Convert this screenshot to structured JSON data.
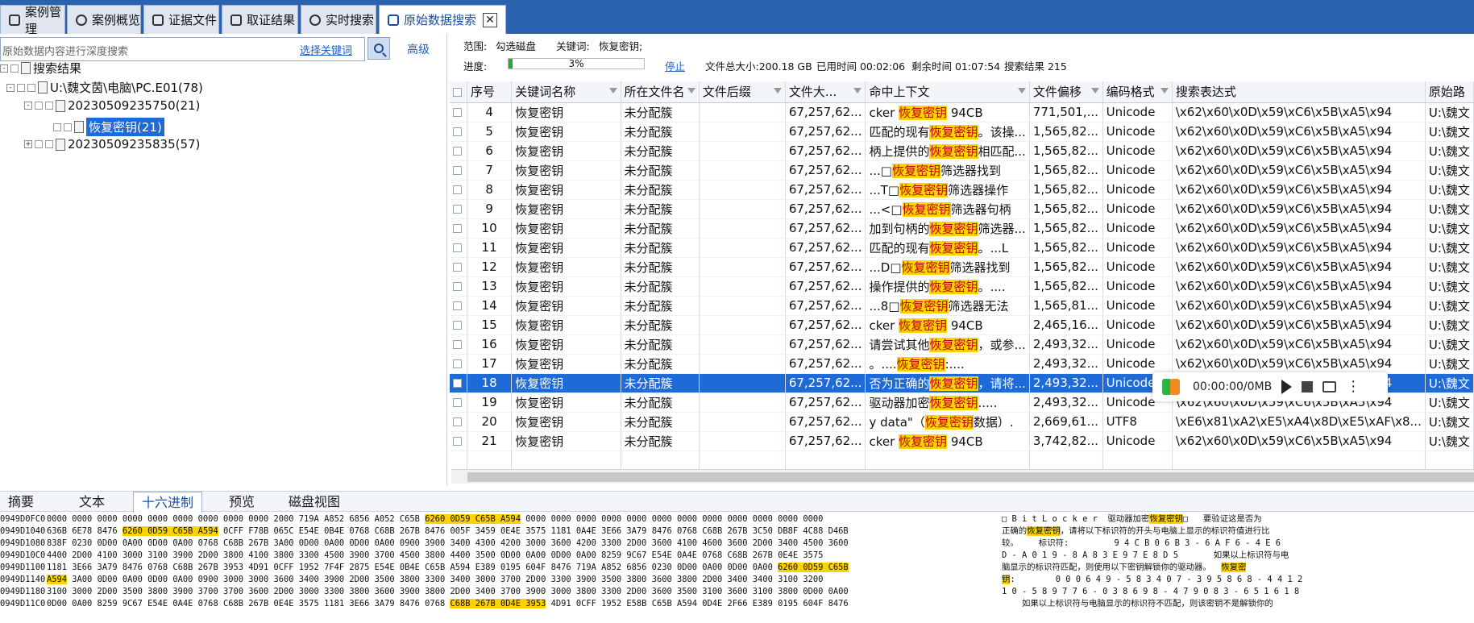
{
  "tabs": [
    {
      "label": "案例管理"
    },
    {
      "label": "案例概览"
    },
    {
      "label": "证据文件"
    },
    {
      "label": "取证结果"
    },
    {
      "label": "实时搜索"
    },
    {
      "label": "原始数据搜索"
    }
  ],
  "left": {
    "search_placeholder": "原始数据内容进行深度搜索",
    "select_keyword": "选择关键词",
    "advanced": "高级",
    "tree": [
      {
        "label": "搜索结果"
      },
      {
        "label": "U:\\魏文茵\\电脑\\PC.E01(78)"
      },
      {
        "label": "20230509235750(21)"
      },
      {
        "label": "恢复密钥(21)"
      },
      {
        "label": "20230509235835(57)"
      }
    ]
  },
  "info": {
    "range_label": "范围:",
    "range_value": "勾选磁盘",
    "keyword_label": "关键词:",
    "keyword_value": "恢复密钥;",
    "progress_label": "进度:",
    "progress_value": "3%",
    "progress_fraction": 0.03,
    "stop": "停止",
    "total_size": "文件总大小:200.18 GB",
    "elapsed": "已用时间 00:02:06",
    "remaining": "剩余时间 01:07:54",
    "results": "搜索结果 215"
  },
  "table": {
    "columns": [
      "序号",
      "关键词名称",
      "所在文件名",
      "文件后缀",
      "文件大...",
      "命中上下文",
      "文件偏移",
      "编码格式",
      "搜索表达式",
      "原始路"
    ],
    "rows": [
      {
        "no": "4",
        "kw": "恢复密钥",
        "file": "未分配簇",
        "ext": "",
        "size": "67,257,62...",
        "pre": "cker ",
        "hit": "恢复密钥",
        "post": " 94CB",
        "offset": "771,501,...",
        "enc": "Unicode",
        "expr": "\\x62\\x60\\x0D\\x59\\xC6\\x5B\\xA5\\x94",
        "path": "U:\\魏文"
      },
      {
        "no": "5",
        "kw": "恢复密钥",
        "file": "未分配簇",
        "ext": "",
        "size": "67,257,62...",
        "pre": "匹配的现有",
        "hit": "恢复密钥",
        "post": "。该操...",
        "offset": "1,565,82...",
        "enc": "Unicode",
        "expr": "\\x62\\x60\\x0D\\x59\\xC6\\x5B\\xA5\\x94",
        "path": "U:\\魏文"
      },
      {
        "no": "6",
        "kw": "恢复密钥",
        "file": "未分配簇",
        "ext": "",
        "size": "67,257,62...",
        "pre": "柄上提供的",
        "hit": "恢复密钥",
        "post": "相匹配...",
        "offset": "1,565,82...",
        "enc": "Unicode",
        "expr": "\\x62\\x60\\x0D\\x59\\xC6\\x5B\\xA5\\x94",
        "path": "U:\\魏文"
      },
      {
        "no": "7",
        "kw": "恢复密钥",
        "file": "未分配簇",
        "ext": "",
        "size": "67,257,62...",
        "pre": "...□",
        "hit": "恢复密钥",
        "post": "筛选器找到",
        "offset": "1,565,82...",
        "enc": "Unicode",
        "expr": "\\x62\\x60\\x0D\\x59\\xC6\\x5B\\xA5\\x94",
        "path": "U:\\魏文"
      },
      {
        "no": "8",
        "kw": "恢复密钥",
        "file": "未分配簇",
        "ext": "",
        "size": "67,257,62...",
        "pre": "...T□",
        "hit": "恢复密钥",
        "post": "筛选器操作",
        "offset": "1,565,82...",
        "enc": "Unicode",
        "expr": "\\x62\\x60\\x0D\\x59\\xC6\\x5B\\xA5\\x94",
        "path": "U:\\魏文"
      },
      {
        "no": "9",
        "kw": "恢复密钥",
        "file": "未分配簇",
        "ext": "",
        "size": "67,257,62...",
        "pre": "...<□",
        "hit": "恢复密钥",
        "post": "筛选器句柄",
        "offset": "1,565,82...",
        "enc": "Unicode",
        "expr": "\\x62\\x60\\x0D\\x59\\xC6\\x5B\\xA5\\x94",
        "path": "U:\\魏文"
      },
      {
        "no": "10",
        "kw": "恢复密钥",
        "file": "未分配簇",
        "ext": "",
        "size": "67,257,62...",
        "pre": "加到句柄的",
        "hit": "恢复密钥",
        "post": "筛选器...",
        "offset": "1,565,82...",
        "enc": "Unicode",
        "expr": "\\x62\\x60\\x0D\\x59\\xC6\\x5B\\xA5\\x94",
        "path": "U:\\魏文"
      },
      {
        "no": "11",
        "kw": "恢复密钥",
        "file": "未分配簇",
        "ext": "",
        "size": "67,257,62...",
        "pre": "匹配的现有",
        "hit": "恢复密钥",
        "post": "。...L",
        "offset": "1,565,82...",
        "enc": "Unicode",
        "expr": "\\x62\\x60\\x0D\\x59\\xC6\\x5B\\xA5\\x94",
        "path": "U:\\魏文"
      },
      {
        "no": "12",
        "kw": "恢复密钥",
        "file": "未分配簇",
        "ext": "",
        "size": "67,257,62...",
        "pre": "...D□",
        "hit": "恢复密钥",
        "post": "筛选器找到",
        "offset": "1,565,82...",
        "enc": "Unicode",
        "expr": "\\x62\\x60\\x0D\\x59\\xC6\\x5B\\xA5\\x94",
        "path": "U:\\魏文"
      },
      {
        "no": "13",
        "kw": "恢复密钥",
        "file": "未分配簇",
        "ext": "",
        "size": "67,257,62...",
        "pre": "操作提供的",
        "hit": "恢复密钥",
        "post": "。....",
        "offset": "1,565,82...",
        "enc": "Unicode",
        "expr": "\\x62\\x60\\x0D\\x59\\xC6\\x5B\\xA5\\x94",
        "path": "U:\\魏文"
      },
      {
        "no": "14",
        "kw": "恢复密钥",
        "file": "未分配簇",
        "ext": "",
        "size": "67,257,62...",
        "pre": "...8□",
        "hit": "恢复密钥",
        "post": "筛选器无法",
        "offset": "1,565,81...",
        "enc": "Unicode",
        "expr": "\\x62\\x60\\x0D\\x59\\xC6\\x5B\\xA5\\x94",
        "path": "U:\\魏文"
      },
      {
        "no": "15",
        "kw": "恢复密钥",
        "file": "未分配簇",
        "ext": "",
        "size": "67,257,62...",
        "pre": "cker ",
        "hit": "恢复密钥",
        "post": " 94CB",
        "offset": "2,465,16...",
        "enc": "Unicode",
        "expr": "\\x62\\x60\\x0D\\x59\\xC6\\x5B\\xA5\\x94",
        "path": "U:\\魏文"
      },
      {
        "no": "16",
        "kw": "恢复密钥",
        "file": "未分配簇",
        "ext": "",
        "size": "67,257,62...",
        "pre": "请尝试其他",
        "hit": "恢复密钥",
        "post": "，或参...",
        "offset": "2,493,32...",
        "enc": "Unicode",
        "expr": "\\x62\\x60\\x0D\\x59\\xC6\\x5B\\xA5\\x94",
        "path": "U:\\魏文"
      },
      {
        "no": "17",
        "kw": "恢复密钥",
        "file": "未分配簇",
        "ext": "",
        "size": "67,257,62...",
        "pre": "。....",
        "hit": "恢复密钥",
        "post": ":....",
        "offset": "2,493,32...",
        "enc": "Unicode",
        "expr": "\\x62\\x60\\x0D\\x59\\xC6\\x5B\\xA5\\x94",
        "path": "U:\\魏文"
      },
      {
        "no": "18",
        "kw": "恢复密钥",
        "file": "未分配簇",
        "ext": "",
        "size": "67,257,62...",
        "pre": "否为正确的",
        "hit": "恢复密钥",
        "post": "，请将...",
        "offset": "2,493,32...",
        "enc": "Unicode",
        "expr": "\\x62\\x60\\x0D\\x59\\xC6\\x5B\\xA5\\x94",
        "path": "U:\\魏文",
        "selected": true
      },
      {
        "no": "19",
        "kw": "恢复密钥",
        "file": "未分配簇",
        "ext": "",
        "size": "67,257,62...",
        "pre": "驱动器加密",
        "hit": "恢复密钥",
        "post": ".....",
        "offset": "2,493,32...",
        "enc": "Unicode",
        "expr": "\\x62\\x60\\x0D\\x59\\xC6\\x5B\\xA5\\x94",
        "path": "U:\\魏文"
      },
      {
        "no": "20",
        "kw": "恢复密钥",
        "file": "未分配簇",
        "ext": "",
        "size": "67,257,62...",
        "pre": "y data\"（",
        "hit": "恢复密钥",
        "post": "数据）.",
        "offset": "2,669,61...",
        "enc": "UTF8",
        "expr": "\\xE6\\x81\\xA2\\xE5\\xA4\\x8D\\xE5\\xAF\\x8...",
        "path": "U:\\魏文"
      },
      {
        "no": "21",
        "kw": "恢复密钥",
        "file": "未分配簇",
        "ext": "",
        "size": "67,257,62...",
        "pre": "cker ",
        "hit": "恢复密钥",
        "post": " 94CB",
        "offset": "3,742,82...",
        "enc": "Unicode",
        "expr": "\\x62\\x60\\x0D\\x59\\xC6\\x5B\\xA5\\x94",
        "path": "U:\\魏文"
      }
    ]
  },
  "player": {
    "time": "00:00:00/0MB"
  },
  "bottom_tabs": [
    {
      "label": "摘要"
    },
    {
      "label": "文本"
    },
    {
      "label": "十六进制"
    },
    {
      "label": "预览"
    },
    {
      "label": "磁盘视图"
    }
  ],
  "hex": [
    {
      "addr": "0949D0FC0",
      "bytes": "0000 0000 0000 0000 0000 0000 0000 0000 0000 2000 719A A852 6856 A052 C65B ",
      "hb": "6260 0D59 C65B A594",
      "ba": " 0000 0000 0000 0000 0000 0000 0000 0000 0000 0000 0000 0000",
      "asc": "□ B i t L o c k e r  驱动器加密",
      "ha": "恢复密钥",
      "aa": "□   要验证这是否为"
    },
    {
      "addr": "0949D1040",
      "bytes": "636B 6E78 8476 ",
      "hb": "6260 0D59 C65B A594",
      "ba": " 0CFF F78B 065C E54E 0B4E 0768 C68B 267B 8476 005F 3459 0E4E 3575 1181 0A4E 3E66 3A79 8476 0768 C68B 267B 3C50 DB8F 4C88 D46B",
      "asc": "正确的",
      "ha": "恢复密钥",
      "aa": "，请将以下标识符的开头与电脑上显示的标识符值进行比"
    },
    {
      "addr": "0949D1080",
      "bytes": "838F 0230 0D00 0A00 0D00 0A00 0768 C68B 267B 3A00 0D00 0A00 0D00 0A00 0900 3900 3400 4300 4200 3000 3600 4200 3300 2D00 3600 4100 4600 3600 2D00 3400 4500 3600",
      "hb": "",
      "ba": "",
      "asc": "较。    标识符:         9 4 C B 0 6 B 3 - 6 A F 6 - 4 E 6",
      "ha": "",
      "aa": ""
    },
    {
      "addr": "0949D10C0",
      "bytes": "4400 2D00 4100 3000 3100 3900 2D00 3800 4100 3800 3300 4500 3900 3700 4500 3800 4400 3500 0D00 0A00 0D00 0A00 8259 9C67 E54E 0A4E 0768 C68B 267B 0E4E 3575",
      "hb": "",
      "ba": "",
      "asc": "D - A 0 1 9 - 8 A 8 3 E 9 7 E 8 D 5       如果以上标识符与电",
      "ha": "",
      "aa": ""
    },
    {
      "addr": "0949D1100",
      "bytes": "1181 3E66 3A79 8476 0768 C68B 267B 3953 4D91 0CFF 1952 7F4F 2875 E54E 0B4E C65B A594 E389 0195 604F 8476 719A A852 6856 0230 0D00 0A00 0D00 0A00 ",
      "hb": "6260 0D59 C65B",
      "ba": "",
      "asc": "脑显示的标识符匹配，则使用以下密钥解锁你的驱动器。  ",
      "ha": "恢复密",
      "aa": ""
    },
    {
      "addr": "0949D1140",
      "bytes": "",
      "hb": "A594",
      "ba": " 3A00 0D00 0A00 0D00 0A00 0900 3000 3000 3600 3400 3900 2D00 3500 3800 3300 3400 3000 3700 2D00 3300 3900 3500 3800 3600 3800 2D00 3400 3400 3100 3200",
      "asc": "",
      "ha": "钥",
      "aa": ":        0 0 0 6 4 9 - 5 8 3 4 0 7 - 3 9 5 8 6 8 - 4 4 1 2"
    },
    {
      "addr": "0949D1180",
      "bytes": "3100 3000 2D00 3500 3800 3900 3700 3700 3600 2D00 3000 3300 3800 3600 3900 3800 2D00 3400 3700 3900 3000 3800 3300 2D00 3600 3500 3100 3600 3100 3800 0D00 0A00",
      "hb": "",
      "ba": "",
      "asc": "1 0 - 5 8 9 7 7 6 - 0 3 8 6 9 8 - 4 7 9 0 8 3 - 6 5 1 6 1 8",
      "ha": "",
      "aa": ""
    },
    {
      "addr": "0949D11C0",
      "bytes": "0D00 0A00 8259 9C67 E54E 0A4E 0768 C68B 267B 0E4E 3575 1181 3E66 3A79 8476 0768 ",
      "hb": "C68B 267B 0D4E 3953",
      "ba": " 4D91 0CFF 1952 E58B C65B A594 0D4E 2F66 E389 0195 604F 8476",
      "asc": "    如果以上标识符与电脑显示的标识符不匹配，则该密钥不是解锁你的",
      "ha": "",
      "aa": ""
    }
  ],
  "colors": {
    "accent": "#1e6ad6",
    "topbar": "#2a62b0",
    "highlight": "#ffd200",
    "progress": "#22aa33"
  }
}
